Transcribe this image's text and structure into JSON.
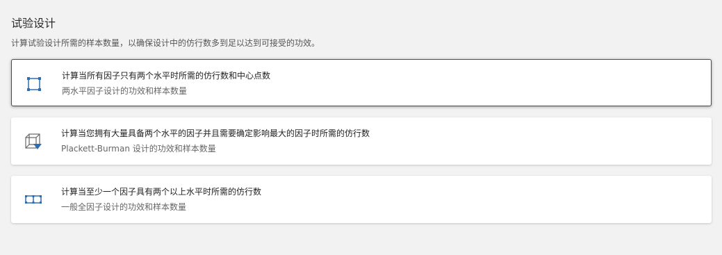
{
  "header": {
    "title": "试验设计",
    "subtitle": "计算试验设计所需的样本数量，以确保设计中的仿行数多到足以达到可接受的功效。"
  },
  "options": [
    {
      "label": "计算当所有因子只有两个水平时所需的仿行数和中心点数",
      "description": "两水平因子设计的功效和样本数量",
      "icon": "two-level-factorial-icon",
      "selected": true
    },
    {
      "label": "计算当您拥有大量具备两个水平的因子并且需要确定影响最大的因子时所需的仿行数",
      "description": "Plackett-Burman 设计的功效和样本数量",
      "icon": "plackett-burman-icon",
      "selected": false
    },
    {
      "label": "计算当至少一个因子具有两个以上水平时所需的仿行数",
      "description": "一般全因子设计的功效和样本数量",
      "icon": "general-full-factorial-icon",
      "selected": false
    }
  ],
  "colors": {
    "icon_blue": "#2f6db3",
    "icon_gray": "#666666",
    "background": "#f2f2f2"
  }
}
